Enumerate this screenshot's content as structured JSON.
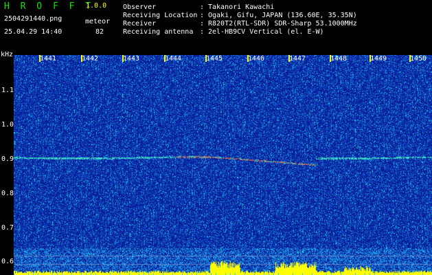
{
  "header": {
    "brand": "H R O F F T",
    "version": "1.0.0",
    "filename": "2504291440.png",
    "datetime": "25.04.29 14:40",
    "meteor_label": "meteor",
    "meteor_count": "82"
  },
  "info": {
    "separator": ":",
    "rows": [
      {
        "label": "Observer",
        "value": "Takanori Kawachi"
      },
      {
        "label": "Receiving Location",
        "value": "Ogaki, Gifu, JAPAN (136.60E, 35.35N)"
      },
      {
        "label": "Receiver",
        "value": "R820T2(RTL-SDR) SDR-Sharp 53.1000MHz"
      },
      {
        "label": "Receiving antenna",
        "value": "2el-HB9CV Vertical (el. E-W)"
      }
    ]
  },
  "axes": {
    "unit": "kHz",
    "minutes": [
      "1441",
      "1442",
      "1443",
      "1444",
      "1445",
      "1446",
      "1447",
      "1448",
      "1449",
      "1450"
    ],
    "freqs": [
      "1.1",
      "1.0",
      "0.9",
      "0.8",
      "0.7",
      "0.6"
    ]
  },
  "colors": {
    "text_green": "#17e000",
    "text_white": "#ffffff",
    "meteor_yellow": "#ffff00",
    "noise_base": "#0a2a9c",
    "tick_yellow": "#ffff00"
  }
}
